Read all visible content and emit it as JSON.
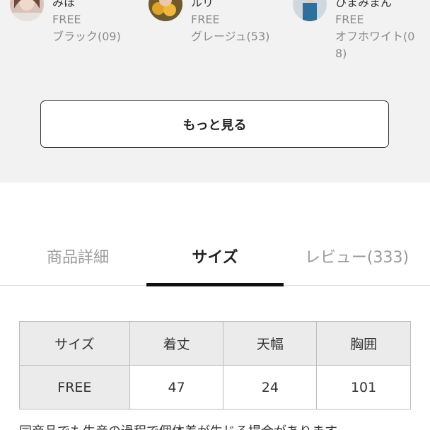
{
  "coordinates": {
    "staff": [
      {
        "name": "みほ",
        "size": "FREE",
        "color": "ブラック(09)"
      },
      {
        "name": "ルリ",
        "size": "FREE",
        "color": "グレージュ(53)"
      },
      {
        "name": "ひまみまん",
        "size": "FREE",
        "color": "オフホワイト(08)"
      }
    ],
    "more_label": "もっと見る"
  },
  "tabs": [
    {
      "label": "商品詳細",
      "active": false
    },
    {
      "label": "サイズ",
      "active": true
    },
    {
      "label": "レビュー(333)",
      "active": false
    }
  ],
  "size_table": {
    "headers": [
      "サイズ",
      "着丈",
      "天幅",
      "胸囲"
    ],
    "rows": [
      [
        "FREE",
        "47",
        "24",
        "101"
      ]
    ]
  },
  "note": "同商品でも生産の過程で個体差が生じる場合があります。",
  "colors": {
    "section_bg": "#f2f2f2",
    "active_indicator": "#111111",
    "table_header_bg": "#ebebeb"
  }
}
